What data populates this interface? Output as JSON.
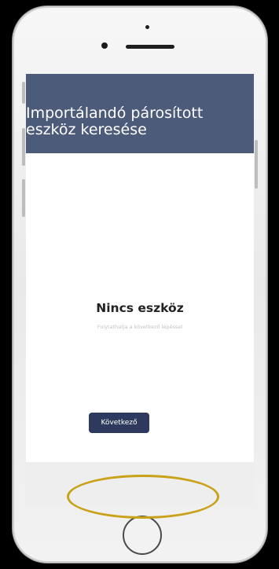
{
  "header": {
    "title_line1": "Importálandó párosított",
    "title_line2": "eszköz keresése"
  },
  "empty_state": {
    "title": "Nincs eszköz",
    "subtitle": "Folytathatja a következő lépéssel"
  },
  "footer": {
    "next_label": "Következő"
  },
  "colors": {
    "header_bg": "#4d5b7a",
    "button_bg": "#2d3a5d",
    "highlight": "#c9a21a",
    "background": "#000000"
  },
  "icons": {
    "home": "home-button-circle",
    "camera": "front-camera-dot",
    "speaker": "earpiece-speaker"
  }
}
